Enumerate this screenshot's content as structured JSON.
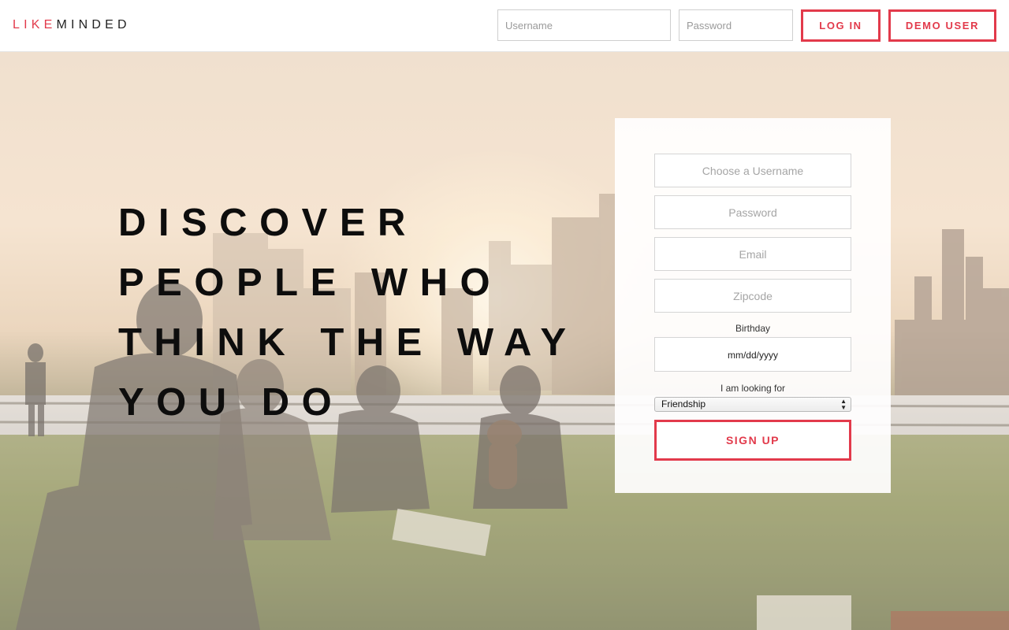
{
  "brand": {
    "part1": "LIKE",
    "part2": "MINDED",
    "accent_color": "#e23a4b"
  },
  "header": {
    "username_placeholder": "Username",
    "password_placeholder": "Password",
    "login_label": "LOG IN",
    "demo_label": "DEMO USER"
  },
  "hero": {
    "headline_lines": [
      "DISCOVER",
      "PEOPLE WHO",
      "THINK THE WAY",
      "YOU DO"
    ]
  },
  "signup": {
    "username_placeholder": "Choose a Username",
    "password_placeholder": "Password",
    "email_placeholder": "Email",
    "zipcode_placeholder": "Zipcode",
    "birthday_label": "Birthday",
    "birthday_value": "mm/dd/yyyy",
    "looking_for_label": "I am looking for",
    "looking_for_value": "Friendship",
    "submit_label": "SIGN UP"
  }
}
